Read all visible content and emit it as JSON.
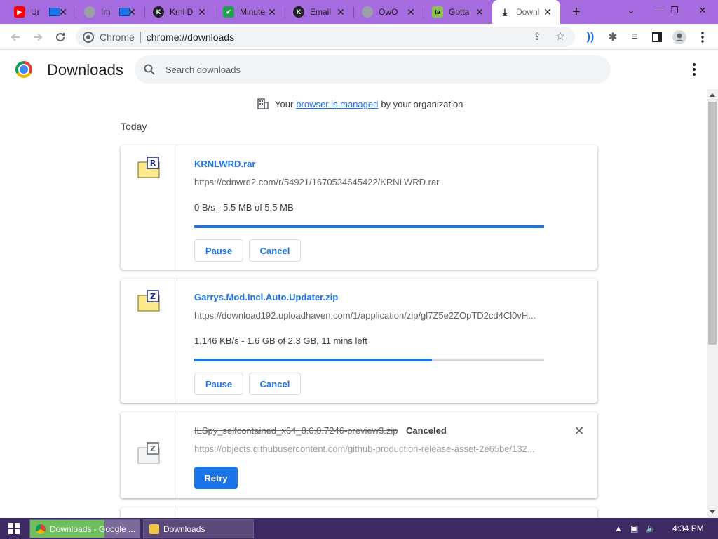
{
  "tabs": [
    {
      "title": "Ur",
      "favicon": "youtube-icon",
      "color": "#ff0000"
    },
    {
      "title": "Im",
      "favicon": "globe-icon",
      "color": "#9aa0a6"
    },
    {
      "title": "Krnl D",
      "favicon": "krnl-icon",
      "color": "#202124"
    },
    {
      "title": "Minute",
      "favicon": "checkmark-icon",
      "color": "#1fa34a"
    },
    {
      "title": "Email",
      "favicon": "krnl-icon",
      "color": "#202124"
    },
    {
      "title": "OwO",
      "favicon": "globe-icon",
      "color": "#9aa0a6"
    },
    {
      "title": "Gotta",
      "favicon": "gotta-icon",
      "color": "#8bc34a"
    },
    {
      "title": "Downl",
      "favicon": "download-icon",
      "color": "#5f6368",
      "active": true
    }
  ],
  "toolbar": {
    "site_label": "Chrome",
    "url": "chrome://downloads"
  },
  "header": {
    "title": "Downloads",
    "search_placeholder": "Search downloads"
  },
  "managed": {
    "prefix": "Your",
    "link": "browser is managed",
    "suffix": "by your organization"
  },
  "date_heading": "Today",
  "downloads": [
    {
      "filename": "KRNLWRD.rar",
      "url": "https://cdnwrd2.com/r/54921/1670534645422/KRNLWRD.rar",
      "description": "0 B/s - 5.5 MB of 5.5 MB",
      "progress": 1.0,
      "icon": "rar-file-icon",
      "icon_letter": "R",
      "buttons": [
        "Pause",
        "Cancel"
      ]
    },
    {
      "filename": "Garrys.Mod.Incl.Auto.Updater.zip",
      "url": "https://download192.uploadhaven.com/1/application/zip/gl7Z5e2ZOpTD2cd4Cl0vH...",
      "description": "1,146 KB/s - 1.6 GB of 2.3 GB, 11 mins left",
      "progress": 0.68,
      "icon": "zip-file-icon",
      "icon_letter": "Z",
      "buttons": [
        "Pause",
        "Cancel"
      ]
    },
    {
      "filename": "ILSpy_selfcontained_x64_8.0.0.7246-preview3.zip",
      "url": "https://objects.githubusercontent.com/github-production-release-asset-2e65be/132...",
      "status": "Canceled",
      "icon": "zip-file-icon",
      "icon_letter": "Z",
      "buttons": [
        "Retry"
      ]
    }
  ],
  "taskbar": {
    "items": [
      "Downloads - Google ...",
      "Downloads"
    ],
    "time": "4:34 PM"
  },
  "colors": {
    "accent": "#1a73e8",
    "tabstrip": "#a76be0",
    "taskbar": "#3e2a63"
  }
}
